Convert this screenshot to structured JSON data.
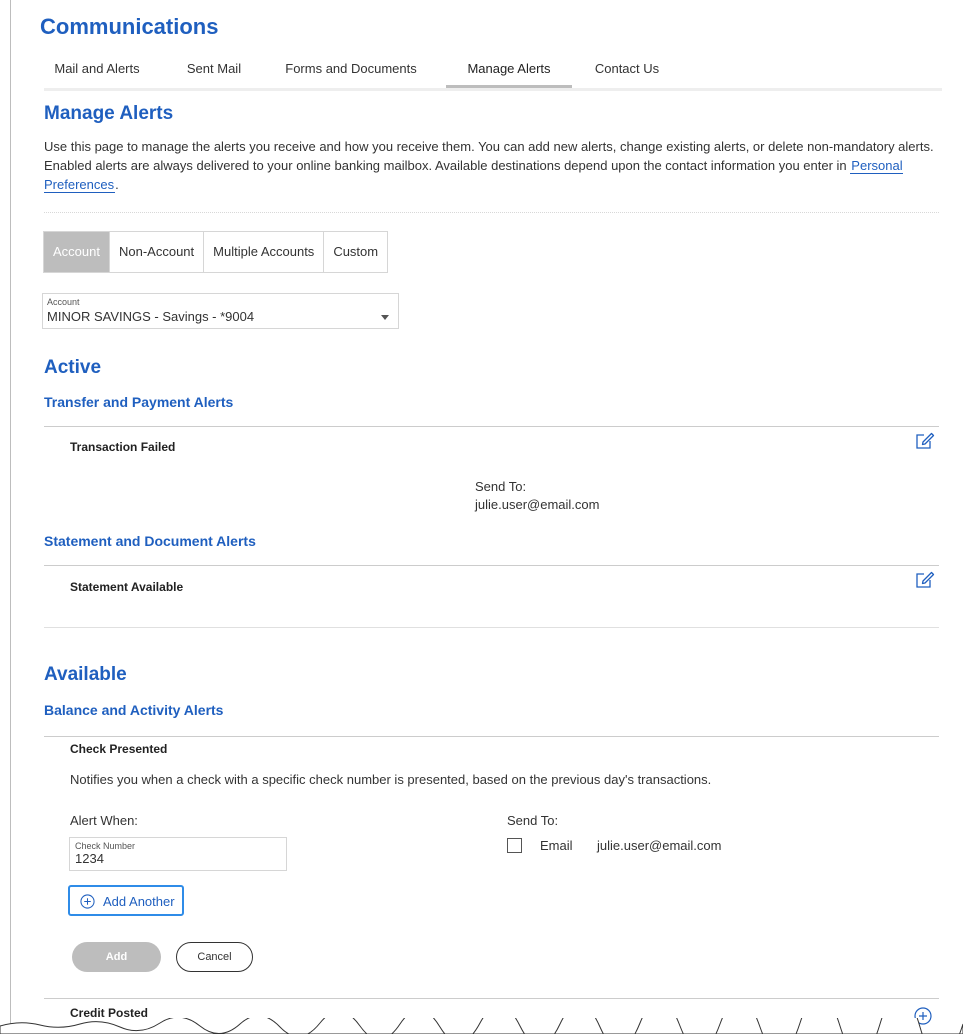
{
  "header": {
    "title": "Communications"
  },
  "tabs": [
    {
      "label": "Mail and Alerts"
    },
    {
      "label": "Sent Mail"
    },
    {
      "label": "Forms and Documents"
    },
    {
      "label": "Manage Alerts"
    },
    {
      "label": "Contact Us"
    }
  ],
  "manage": {
    "title": "Manage Alerts",
    "intro": "Use this page to manage the alerts you receive and how you receive them. You can add new alerts, change existing alerts, or delete non-mandatory alerts. Enabled alerts are always delivered to your online banking mailbox. Available destinations depend upon the contact information you enter in",
    "link": "Personal Preferences",
    "intro_end": "."
  },
  "segments": [
    {
      "label": "Account"
    },
    {
      "label": "Non-Account"
    },
    {
      "label": "Multiple Accounts"
    },
    {
      "label": "Custom"
    }
  ],
  "account_select": {
    "label": "Account",
    "value": "MINOR SAVINGS - Savings - *9004"
  },
  "active": {
    "title": "Active",
    "groups": [
      {
        "title": "Transfer and Payment Alerts",
        "alert": "Transaction Failed",
        "send_to_label": "Send To:",
        "send_to_value": "julie.user@email.com"
      },
      {
        "title": "Statement and Document Alerts",
        "alert": "Statement Available"
      }
    ]
  },
  "available": {
    "title": "Available",
    "group_title": "Balance and Activity Alerts",
    "alert": "Check Presented",
    "description": "Notifies you when a check with a specific check number is presented, based on the previous day's transactions.",
    "alert_when_label": "Alert When:",
    "check_number_label": "Check Number",
    "check_number_value": "1234",
    "send_to_label": "Send To:",
    "email_label": "Email",
    "email_value": "julie.user@email.com",
    "add_another": "Add Another",
    "add_button": "Add",
    "cancel_button": "Cancel",
    "next_alert": "Credit Posted"
  },
  "colors": {
    "accent": "#1f5fbf",
    "focus": "#2f8ce8",
    "disabled": "#bdbdbd"
  }
}
